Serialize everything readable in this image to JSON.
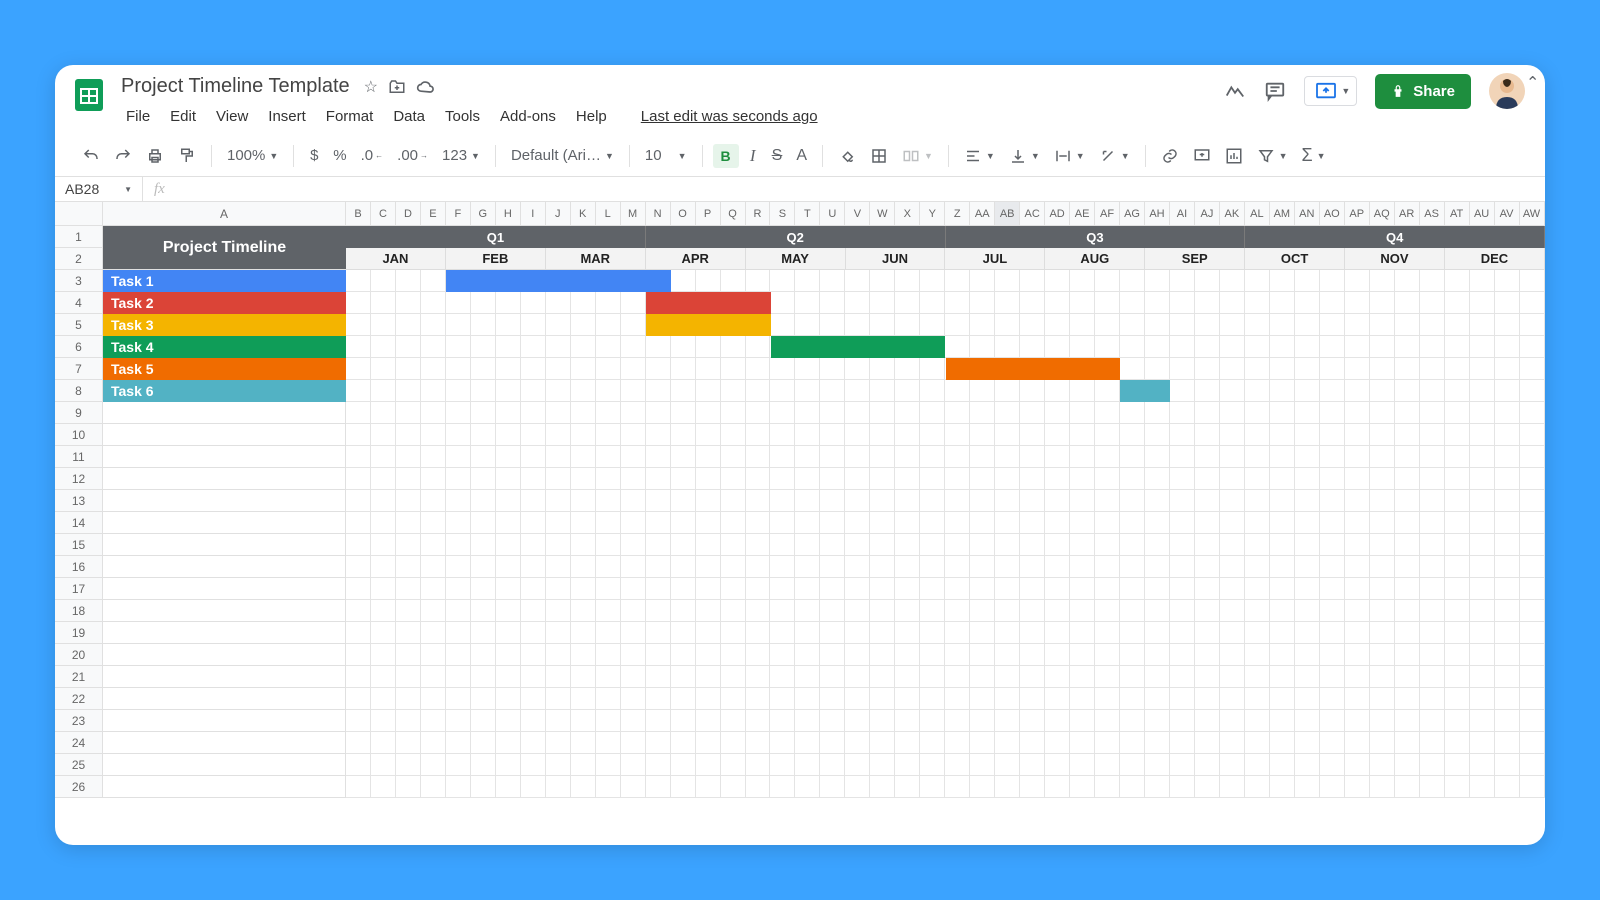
{
  "doc": {
    "title": "Project Timeline Template",
    "last_edit": "Last edit was seconds ago"
  },
  "menus": [
    "File",
    "Edit",
    "View",
    "Insert",
    "Format",
    "Data",
    "Tools",
    "Add-ons",
    "Help"
  ],
  "toolbar": {
    "zoom": "100%",
    "font": "Default (Ari…",
    "font_size": "10",
    "bold": "B",
    "italic": "I",
    "strike": "S",
    "textA": "A",
    "fmt123": "123",
    "currency": "$",
    "percent": "%"
  },
  "share": {
    "label": "Share"
  },
  "namebox": "AB28",
  "fx_placeholder": "fx",
  "col_A_label": "A",
  "columns": [
    "B",
    "C",
    "D",
    "E",
    "F",
    "G",
    "H",
    "I",
    "J",
    "K",
    "L",
    "M",
    "N",
    "O",
    "P",
    "Q",
    "R",
    "S",
    "T",
    "U",
    "V",
    "W",
    "X",
    "Y",
    "Z",
    "AA",
    "AB",
    "AC",
    "AD",
    "AE",
    "AF",
    "AG",
    "AH",
    "AI",
    "AJ",
    "AK",
    "AL",
    "AM",
    "AN",
    "AO",
    "AP",
    "AQ",
    "AR",
    "AS",
    "AT",
    "AU",
    "AV",
    "AW"
  ],
  "selected_col": "AB",
  "row_count": 26,
  "timeline": {
    "title": "Project Timeline",
    "quarters": [
      "Q1",
      "Q2",
      "Q3",
      "Q4"
    ],
    "months": [
      "JAN",
      "FEB",
      "MAR",
      "APR",
      "MAY",
      "JUN",
      "JUL",
      "AUG",
      "SEP",
      "OCT",
      "NOV",
      "DEC"
    ],
    "tasks": [
      {
        "name": "Task 1",
        "color": "#4285f4",
        "start": 4,
        "span": 9
      },
      {
        "name": "Task 2",
        "color": "#db4437",
        "start": 12,
        "span": 5
      },
      {
        "name": "Task 3",
        "color": "#f4b400",
        "start": 12,
        "span": 5
      },
      {
        "name": "Task 4",
        "color": "#0f9d58",
        "start": 17,
        "span": 7
      },
      {
        "name": "Task 5",
        "color": "#f06c00",
        "start": 24,
        "span": 7
      },
      {
        "name": "Task 6",
        "color": "#52b2c4",
        "start": 31,
        "span": 2
      }
    ]
  },
  "colors": {
    "hdr_dark": "#5f6368"
  }
}
